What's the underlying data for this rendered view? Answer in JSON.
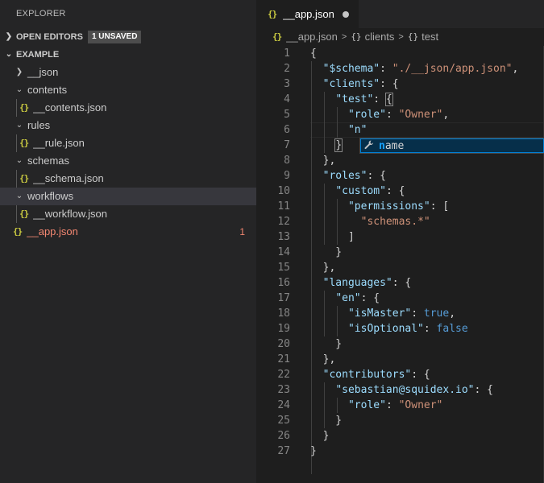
{
  "sidebar": {
    "title": "EXPLORER",
    "open_editors": {
      "label": "OPEN EDITORS",
      "badge": "1 UNSAVED"
    },
    "workspace": {
      "label": "EXAMPLE"
    },
    "tree": [
      {
        "label": "__json",
        "type": "folder-collapsed"
      },
      {
        "label": "contents",
        "type": "folder-open"
      },
      {
        "label": "__contents.json",
        "type": "file",
        "icon": "{}"
      },
      {
        "label": "rules",
        "type": "folder-open"
      },
      {
        "label": "__rule.json",
        "type": "file",
        "icon": "{}"
      },
      {
        "label": "schemas",
        "type": "folder-open"
      },
      {
        "label": "__schema.json",
        "type": "file",
        "icon": "{}"
      },
      {
        "label": "workflows",
        "type": "folder-open"
      },
      {
        "label": "__workflow.json",
        "type": "file",
        "icon": "{}"
      },
      {
        "label": "__app.json",
        "type": "file-root",
        "icon": "{}",
        "problems": "1"
      }
    ]
  },
  "editor": {
    "tab": {
      "icon": "{}",
      "label": "__app.json"
    },
    "breadcrumb": {
      "icon": "{}",
      "file": "__app.json",
      "sep": ">",
      "obj_icon": "{}",
      "crumb1": "clients",
      "crumb2": "test"
    },
    "suggestion": {
      "icon": "wrench-icon",
      "match": "n",
      "rest": "ame"
    },
    "line_numbers": [
      "1",
      "2",
      "3",
      "4",
      "5",
      "6",
      "7",
      "8",
      "9",
      "10",
      "11",
      "12",
      "13",
      "14",
      "15",
      "16",
      "17",
      "18",
      "19",
      "20",
      "21",
      "22",
      "23",
      "24",
      "25",
      "26",
      "27"
    ]
  },
  "colors": {
    "key": "#9cdcfe",
    "string": "#ce9178",
    "boolean": "#569cd6",
    "error": "#f48771",
    "json_icon": "#cbcb41"
  }
}
